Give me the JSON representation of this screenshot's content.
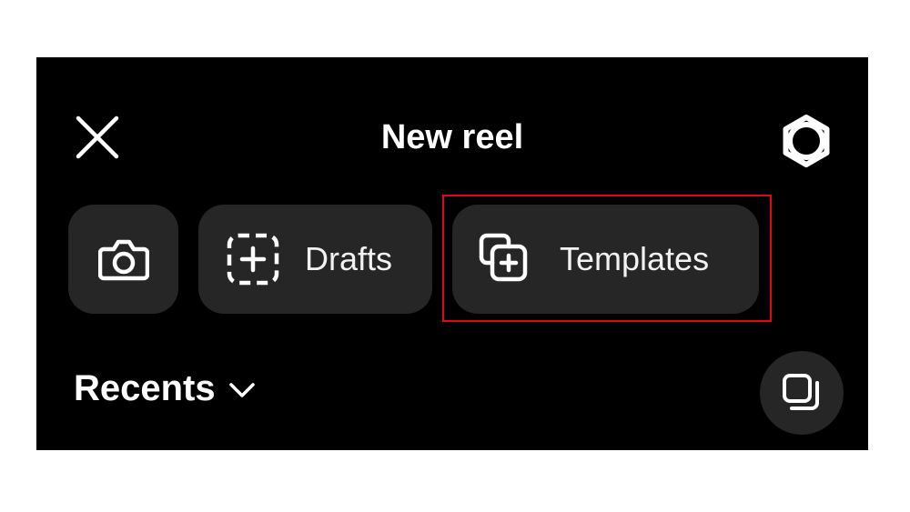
{
  "header": {
    "title": "New reel",
    "close_icon": "close-icon",
    "settings_icon": "settings-gear-icon"
  },
  "chips": {
    "camera": {
      "icon": "camera-icon"
    },
    "drafts": {
      "label": "Drafts",
      "icon": "add-dashed-square-icon"
    },
    "templates": {
      "label": "Templates",
      "icon": "templates-stack-add-icon"
    }
  },
  "gallery": {
    "recents_label": "Recents",
    "dropdown_icon": "chevron-down-icon",
    "multi_select_icon": "multi-select-icon"
  },
  "colors": {
    "background": "#000000",
    "chip": "#262626",
    "text": "#ffffff",
    "highlight": "#e30613"
  }
}
